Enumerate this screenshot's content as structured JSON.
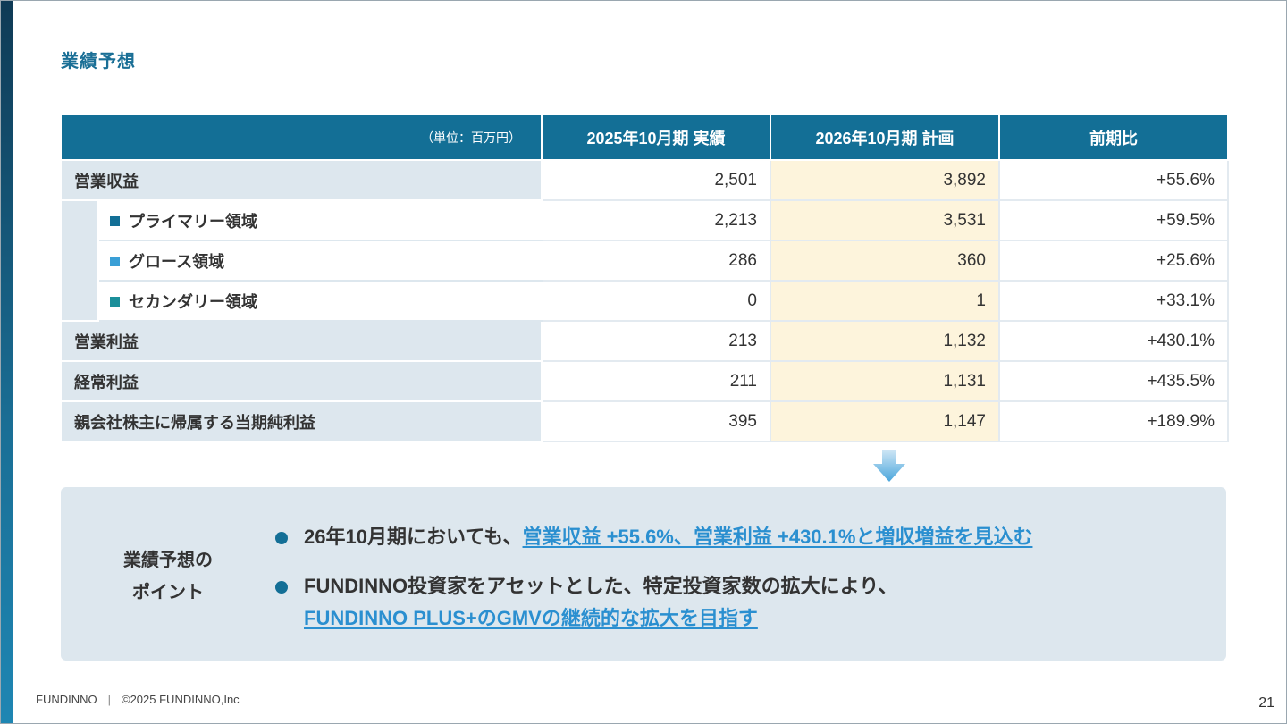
{
  "title": "業績予想",
  "table": {
    "unit_label": "（単位：百万円）",
    "columns": [
      "2025年10月期 実績",
      "2026年10月期 計画",
      "前期比"
    ],
    "rows": [
      {
        "label": "営業収益",
        "actual": "2,501",
        "plan": "3,892",
        "yoy": "+55.6%"
      },
      {
        "label": "プライマリー領域",
        "actual": "2,213",
        "plan": "3,531",
        "yoy": "+59.5%",
        "marker_color": "#136f96"
      },
      {
        "label": "グロース領域",
        "actual": "286",
        "plan": "360",
        "yoy": "+25.6%",
        "marker_color": "#3a9fd6"
      },
      {
        "label": "セカンダリー領域",
        "actual": "0",
        "plan": "1",
        "yoy": "+33.1%",
        "marker_color": "#1b8f9a"
      },
      {
        "label": "営業利益",
        "actual": "213",
        "plan": "1,132",
        "yoy": "+430.1%"
      },
      {
        "label": "経常利益",
        "actual": "211",
        "plan": "1,131",
        "yoy": "+435.5%"
      },
      {
        "label": "親会社株主に帰属する当期純利益",
        "actual": "395",
        "plan": "1,147",
        "yoy": "+189.9%"
      }
    ]
  },
  "points": {
    "heading_line1": "業績予想の",
    "heading_line2": "ポイント",
    "bullet1_plain": "26年10月期においても、",
    "bullet1_highlight": "営業収益 +55.6%、営業利益 +430.1%と増収増益を見込む",
    "bullet2_line1": "FUNDINNO投資家をアセットとした、特定投資家数の拡大により、",
    "bullet2_highlight": "FUNDINNO PLUS+のGMVの継続的な拡大を目指す"
  },
  "footer": {
    "brand": "FUNDINNO",
    "separator": "|",
    "copyright": "©2025 FUNDINNO,Inc",
    "page_number": "21"
  },
  "colors": {
    "header_blue": "#136f96",
    "label_bg": "#dde7ee",
    "plan_bg": "#fdf4dc",
    "highlight_text": "#2a8fd0"
  }
}
